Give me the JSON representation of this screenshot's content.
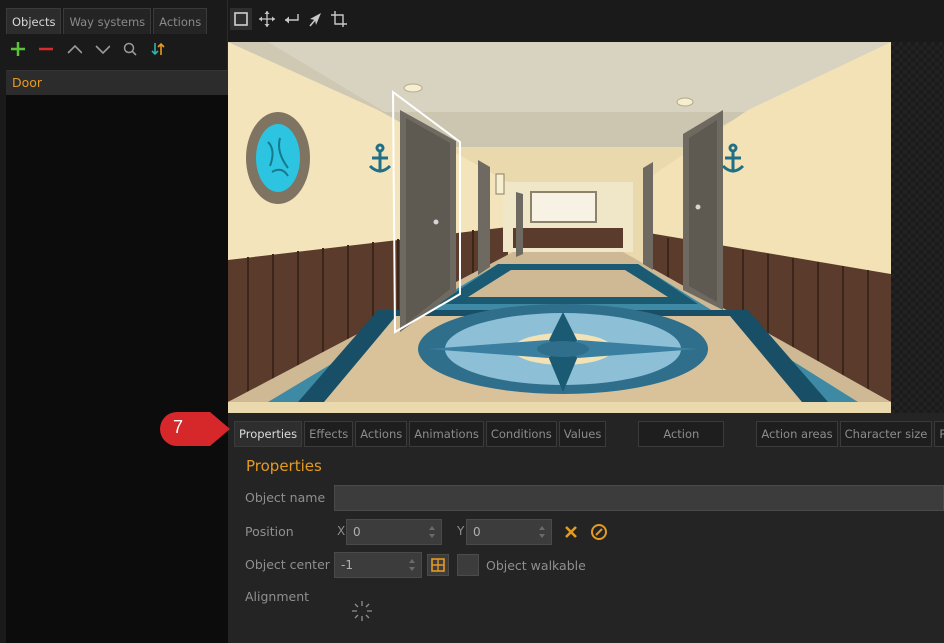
{
  "left_panel": {
    "tabs": [
      {
        "label": "Objects",
        "active": true
      },
      {
        "label": "Way systems",
        "active": false
      },
      {
        "label": "Actions",
        "active": false
      }
    ],
    "toolbar_icons": [
      "add-icon",
      "remove-icon",
      "move-up-icon",
      "move-down-icon",
      "search-icon",
      "sort-icon"
    ],
    "objects": [
      "Door"
    ]
  },
  "top_toolbar": {
    "icons": [
      "select-rect-icon",
      "move-icon",
      "return-icon",
      "pointer-icon",
      "crop-icon"
    ]
  },
  "bottom_panel": {
    "tabs": [
      {
        "label": "Properties",
        "active": true
      },
      {
        "label": "Effects",
        "active": false
      },
      {
        "label": "Actions",
        "active": false
      },
      {
        "label": "Animations",
        "active": false
      },
      {
        "label": "Conditions",
        "active": false
      },
      {
        "label": "Values",
        "active": false
      },
      {
        "label": "Action",
        "active": false
      },
      {
        "label": "Action areas",
        "active": false
      },
      {
        "label": "Character size",
        "active": false
      },
      {
        "label": "Pre",
        "active": false
      }
    ],
    "properties": {
      "heading": "Properties",
      "object_name_label": "Object name",
      "object_name_value": "",
      "position_label": "Position",
      "x_label": "X",
      "x_value": "0",
      "y_label": "Y",
      "y_value": "0",
      "object_center_label": "Object center",
      "object_center_value": "-1",
      "object_walkable_label": "Object walkable",
      "alignment_label": "Alignment"
    }
  },
  "callout": {
    "number": "7"
  },
  "colors": {
    "accent": "#e59a22",
    "callout": "#d6282b",
    "selection": "#ffffff"
  }
}
